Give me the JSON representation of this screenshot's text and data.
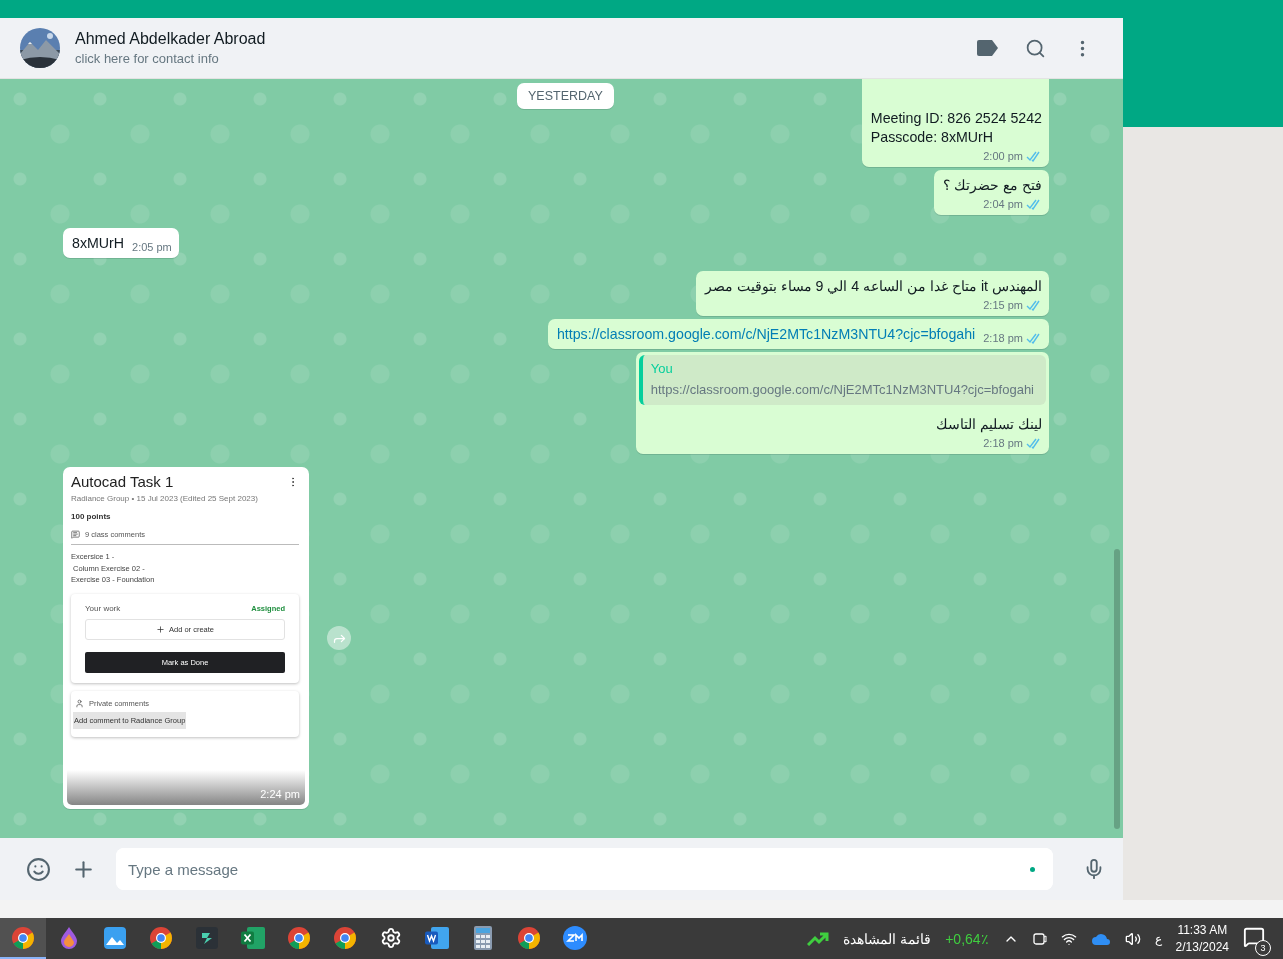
{
  "contact": {
    "name": "Ahmed Abdelkader Abroad",
    "subtitle": "click here for contact info"
  },
  "date_chip": "YESTERDAY",
  "messages": [
    {
      "kind": "text",
      "outgoing": true,
      "lines": [
        {
          "kind": "plain",
          "text": "Meeting ID: 826 2524 5242"
        },
        {
          "kind": "plain",
          "text": "Passcode: 8xMUrH"
        }
      ],
      "time": "2:00 pm",
      "read": true
    },
    {
      "kind": "text",
      "outgoing": true,
      "lines": [
        {
          "kind": "plain",
          "text": "فتح مع حضرتك ؟"
        }
      ],
      "time": "2:04 pm",
      "read": true
    },
    {
      "kind": "inline",
      "outgoing": false,
      "lines": [
        {
          "kind": "plain",
          "text": "8xMUrH"
        }
      ],
      "time": "2:05 pm"
    },
    {
      "kind": "text",
      "outgoing": true,
      "lines": [
        {
          "kind": "plain",
          "text": "المهندس it متاح غدا من الساعه 4 الي 9 مساء بتوقيت مصر"
        }
      ],
      "time": "2:15 pm",
      "read": true
    },
    {
      "kind": "inline",
      "outgoing": true,
      "lines": [
        {
          "kind": "link",
          "text": "https://classroom.google.com/c/NjE2MTc1NzM3NTU4?cjc=bfogahi"
        }
      ],
      "time": "2:18 pm",
      "read": true
    },
    {
      "kind": "reply",
      "outgoing": true,
      "quote_author": "You",
      "quote_text": "https://classroom.google.com/c/NjE2MTc1NzM3NTU4?cjc=bfogahi",
      "lines": [
        {
          "kind": "plain",
          "text": "لينك تسليم التاسك"
        }
      ],
      "time": "2:18 pm",
      "read": true
    },
    {
      "kind": "card",
      "outgoing": false,
      "time": "2:24 pm",
      "card": {
        "title": "Autocad Task 1",
        "meta": "Radiance Group • 15 Jul 2023 (Edited 25 Sept 2023)",
        "points": "100 points",
        "comments": "9 class comments",
        "description": [
          "Excersice 1 -",
          " Column Exercise 02 -",
          "Exercise 03 - Foundation"
        ],
        "work_label": "Your work",
        "status": "Assigned",
        "add_label": "Add or create",
        "done_label": "Mark as Done",
        "private_label": "Private comments",
        "private_placeholder": "Add comment to Radiance Group"
      }
    }
  ],
  "composer": {
    "placeholder": "Type a message"
  },
  "tray": {
    "ticker_change": "+0,64٪",
    "ticker_label": "قائمة المشاهدة",
    "language": "ع",
    "time": "11:33 AM",
    "date": "2/13/2024",
    "notifications": "3"
  }
}
